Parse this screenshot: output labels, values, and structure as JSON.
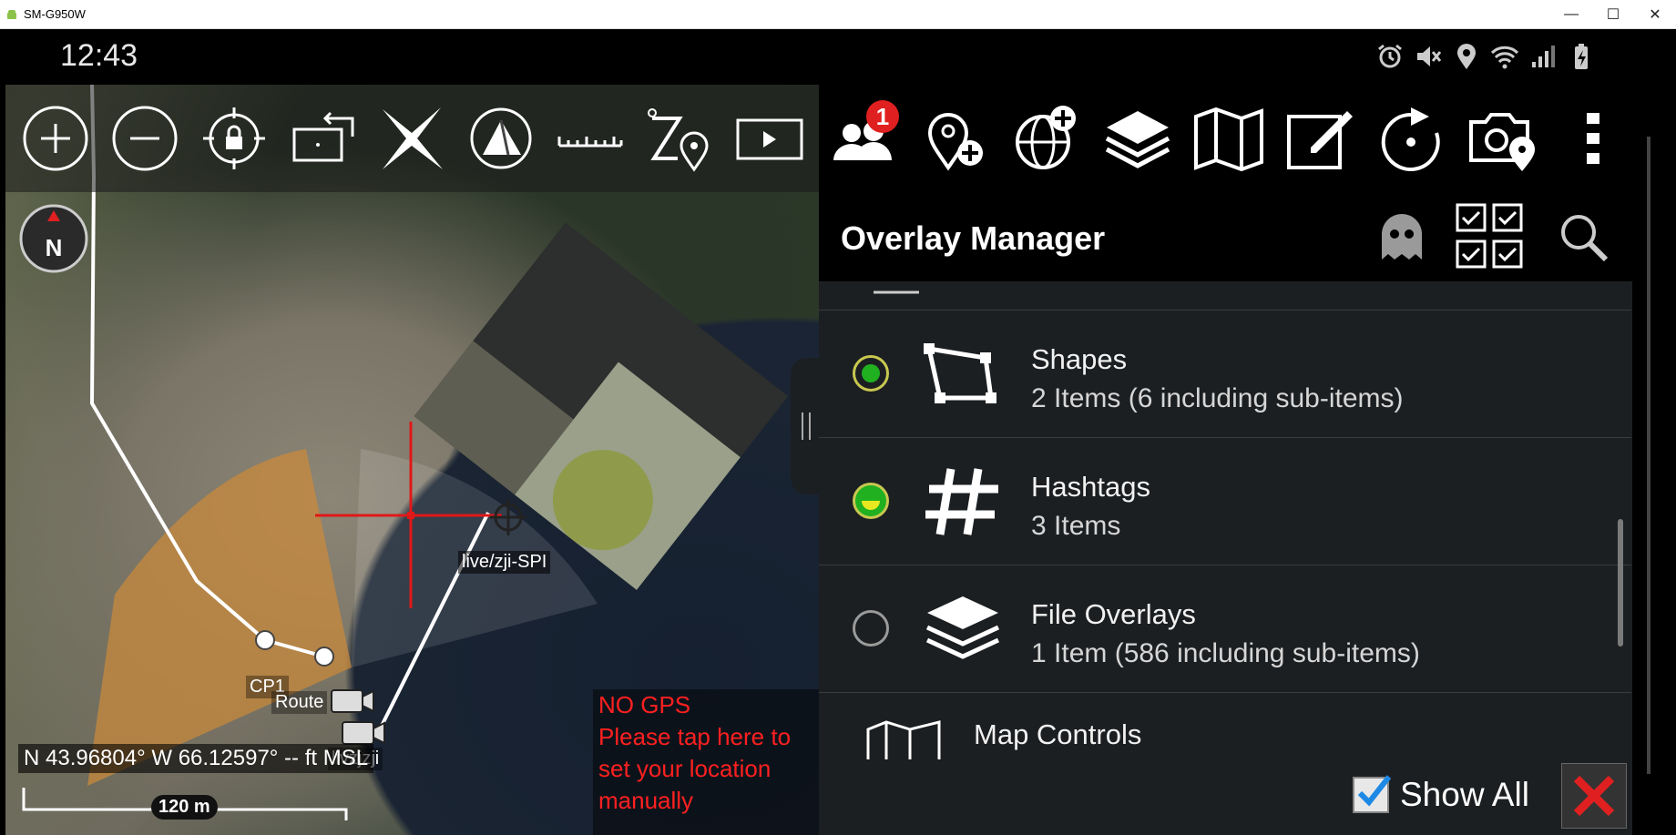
{
  "window": {
    "title": "SM-G950W",
    "minimize": "—",
    "maximize": "☐",
    "close": "✕"
  },
  "status": {
    "time": "12:43",
    "icons": [
      "alarm-icon",
      "mute-icon",
      "location-icon",
      "wifi-icon",
      "signal-icon",
      "battery-icon"
    ]
  },
  "map_toolbar": {
    "buttons": [
      "zoom-in",
      "zoom-out",
      "lock-location",
      "rotate-map",
      "clear",
      "tilt-3d",
      "ruler",
      "red-zoom",
      "video"
    ]
  },
  "map": {
    "compass_label": "N",
    "coords": "N 43.96804°  W 66.12597°  -- ft MSL",
    "scale_label": "120 m",
    "labels": {
      "spi": "live/zji-SPI",
      "cp1": "CP1",
      "route": "Route",
      "cam": "livzjzji"
    },
    "nogps": [
      "NO GPS",
      "Please tap here to",
      "set your location",
      "manually"
    ]
  },
  "right_toolbar": {
    "contacts_badge": "1"
  },
  "overlay_manager": {
    "title": "Overlay Manager",
    "items": [
      {
        "title": "Shapes",
        "subtitle": "2 Items (6 including sub-items)",
        "state": "on",
        "dot_color": "#20b020"
      },
      {
        "title": "Hashtags",
        "subtitle": "3 Items",
        "state": "partial",
        "dot_color": "#e8e820"
      },
      {
        "title": "File Overlays",
        "subtitle": "1 Item (586 including sub-items)",
        "state": "off",
        "dot_color": ""
      },
      {
        "title": "Map Controls",
        "subtitle": ""
      }
    ],
    "show_all_label": "Show All",
    "accent": "#1e88e5"
  }
}
